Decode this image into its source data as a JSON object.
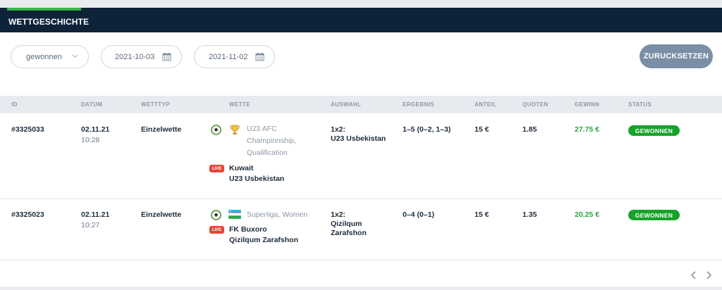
{
  "header": {
    "title": "WETTGESCHICHTE",
    "accent_color": "#3bb54a",
    "bg_color": "#0e2238"
  },
  "filters": {
    "status_value": "gewonnen",
    "date_from": "2021-10-03",
    "date_to": "2021-11-02",
    "reset_label": "ZURUCKSETZEN"
  },
  "table": {
    "headers": {
      "id": "ID",
      "datum": "DATUM",
      "wetttyp": "WETTTYP",
      "wette": "WETTE",
      "auswahl": "AUSWAHL",
      "ergebnis": "ERGEBNIS",
      "anteil": "ANTEIL",
      "quoten": "QUOTEN",
      "gewinn": "GEWINN",
      "status": "STATUS"
    },
    "rows": [
      {
        "id": "#3325033",
        "date": "02.11.21",
        "time": "10:28",
        "type": "Einzelwette",
        "league_line1": "U23 AFC",
        "league_line2": "Championship,",
        "league_line3": "Qualification",
        "live": "LIVE",
        "team1": "Kuwait",
        "team2": "U23 Usbekistan",
        "selection_label": "1x2:",
        "selection_value": "U23 Usbekistan",
        "result": "1–5 (0–2, 1–3)",
        "stake": "15 €",
        "odds": "1.85",
        "win": "27.75 €",
        "status": "GEWONNEN",
        "league_icon": "trophy-icon"
      },
      {
        "id": "#3325023",
        "date": "02.11.21",
        "time": "10:27",
        "type": "Einzelwette",
        "league_line1": "Superliga, Women",
        "live": "LIVE",
        "team1": "FK Buxoro",
        "team2": "Qizilqum Zarafshon",
        "selection_label": "1x2:",
        "selection_value_line1": "Qizilqum",
        "selection_value_line2": "Zarafshon",
        "result": "0–4 (0–1)",
        "stake": "15 €",
        "odds": "1.35",
        "win": "20.25 €",
        "status": "GEWONNEN",
        "league_icon": "uzbekistan-flag-icon"
      }
    ]
  },
  "colors": {
    "win_green": "#2aa53a",
    "badge_green": "#16a32a",
    "live_red": "#e8443a",
    "reset_bg": "#7a8fa6"
  }
}
